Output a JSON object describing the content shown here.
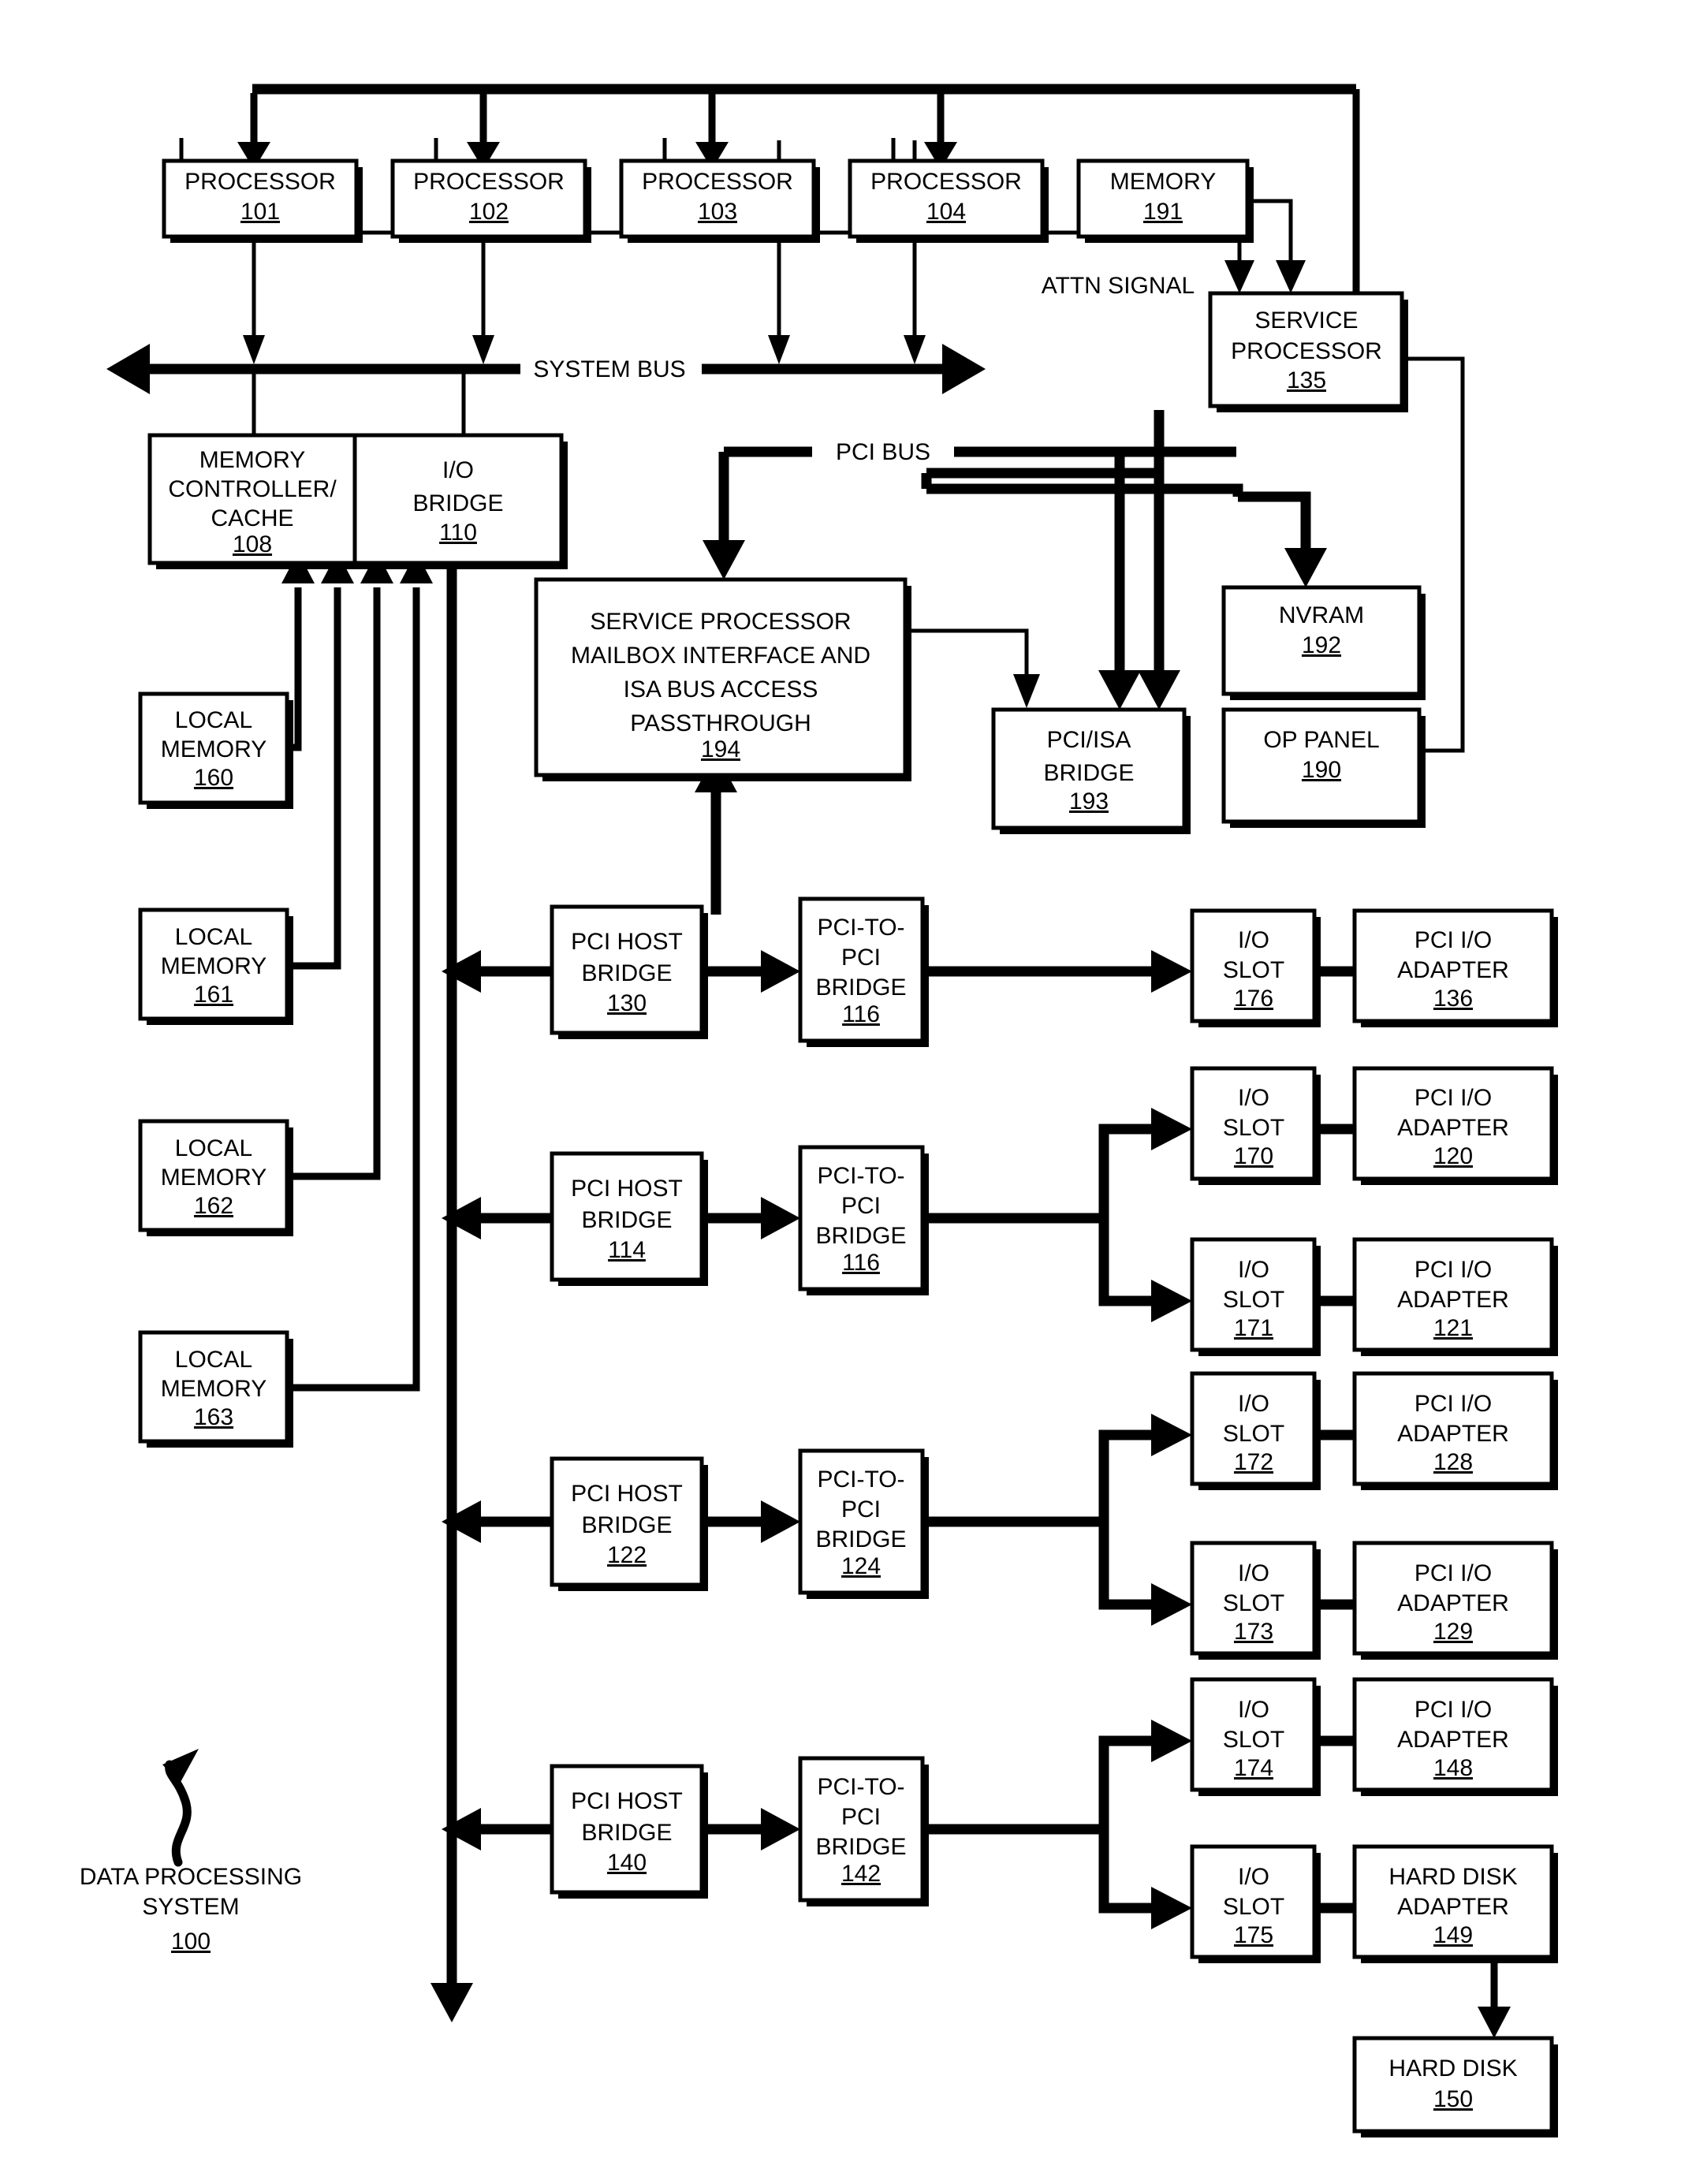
{
  "figure": {
    "caption_label": "DATA PROCESSING",
    "caption_label2": "SYSTEM",
    "caption_ref": "100"
  },
  "bus_labels": {
    "system_bus": "SYSTEM BUS",
    "pci_bus": "PCI BUS",
    "attn_signal": "ATTN SIGNAL"
  },
  "colors": {
    "ink": "#000000",
    "paper": "#ffffff"
  },
  "blocks": {
    "processors": [
      {
        "lines": [
          "PROCESSOR"
        ],
        "ref": "101"
      },
      {
        "lines": [
          "PROCESSOR"
        ],
        "ref": "102"
      },
      {
        "lines": [
          "PROCESSOR"
        ],
        "ref": "103"
      },
      {
        "lines": [
          "PROCESSOR"
        ],
        "ref": "104"
      }
    ],
    "memory": {
      "lines": [
        "MEMORY"
      ],
      "ref": "191"
    },
    "service_processor": {
      "lines": [
        "SERVICE",
        "PROCESSOR"
      ],
      "ref": "135"
    },
    "memory_controller": {
      "lines": [
        "MEMORY",
        "CONTROLLER/",
        "CACHE"
      ],
      "ref": "108"
    },
    "io_bridge": {
      "lines": [
        "I/O",
        "BRIDGE"
      ],
      "ref": "110"
    },
    "sp_mailbox": {
      "lines": [
        "SERVICE PROCESSOR",
        "MAILBOX INTERFACE AND",
        "ISA BUS ACCESS",
        "PASSTHROUGH"
      ],
      "ref": "194"
    },
    "pci_isa_bridge": {
      "lines": [
        "PCI/ISA",
        "BRIDGE"
      ],
      "ref": "193"
    },
    "nvram": {
      "lines": [
        "NVRAM"
      ],
      "ref": "192"
    },
    "op_panel": {
      "lines": [
        "OP PANEL"
      ],
      "ref": "190"
    },
    "local_memories": [
      {
        "lines": [
          "LOCAL",
          "MEMORY"
        ],
        "ref": "160"
      },
      {
        "lines": [
          "LOCAL",
          "MEMORY"
        ],
        "ref": "161"
      },
      {
        "lines": [
          "LOCAL",
          "MEMORY"
        ],
        "ref": "162"
      },
      {
        "lines": [
          "LOCAL",
          "MEMORY"
        ],
        "ref": "163"
      }
    ],
    "pci_host_bridges": [
      {
        "lines": [
          "PCI HOST",
          "BRIDGE"
        ],
        "ref": "130"
      },
      {
        "lines": [
          "PCI HOST",
          "BRIDGE"
        ],
        "ref": "114"
      },
      {
        "lines": [
          "PCI HOST",
          "BRIDGE"
        ],
        "ref": "122"
      },
      {
        "lines": [
          "PCI HOST",
          "BRIDGE"
        ],
        "ref": "140"
      }
    ],
    "pci_to_pci_bridges": [
      {
        "lines": [
          "PCI-TO-",
          "PCI",
          "BRIDGE"
        ],
        "ref": "116"
      },
      {
        "lines": [
          "PCI-TO-",
          "PCI",
          "BRIDGE"
        ],
        "ref": "116"
      },
      {
        "lines": [
          "PCI-TO-",
          "PCI",
          "BRIDGE"
        ],
        "ref": "124"
      },
      {
        "lines": [
          "PCI-TO-",
          "PCI",
          "BRIDGE"
        ],
        "ref": "142"
      }
    ],
    "io_slots": [
      {
        "lines": [
          "I/O",
          "SLOT"
        ],
        "ref": "176"
      },
      {
        "lines": [
          "I/O",
          "SLOT"
        ],
        "ref": "170"
      },
      {
        "lines": [
          "I/O",
          "SLOT"
        ],
        "ref": "171"
      },
      {
        "lines": [
          "I/O",
          "SLOT"
        ],
        "ref": "172"
      },
      {
        "lines": [
          "I/O",
          "SLOT"
        ],
        "ref": "173"
      },
      {
        "lines": [
          "I/O",
          "SLOT"
        ],
        "ref": "174"
      },
      {
        "lines": [
          "I/O",
          "SLOT"
        ],
        "ref": "175"
      }
    ],
    "adapters": [
      {
        "lines": [
          "PCI I/O",
          "ADAPTER"
        ],
        "ref": "136"
      },
      {
        "lines": [
          "PCI I/O",
          "ADAPTER"
        ],
        "ref": "120"
      },
      {
        "lines": [
          "PCI I/O",
          "ADAPTER"
        ],
        "ref": "121"
      },
      {
        "lines": [
          "PCI I/O",
          "ADAPTER"
        ],
        "ref": "128"
      },
      {
        "lines": [
          "PCI I/O",
          "ADAPTER"
        ],
        "ref": "129"
      },
      {
        "lines": [
          "PCI I/O",
          "ADAPTER"
        ],
        "ref": "148"
      },
      {
        "lines": [
          "HARD DISK",
          "ADAPTER"
        ],
        "ref": "149"
      }
    ],
    "hard_disk": {
      "lines": [
        "HARD DISK"
      ],
      "ref": "150"
    }
  }
}
